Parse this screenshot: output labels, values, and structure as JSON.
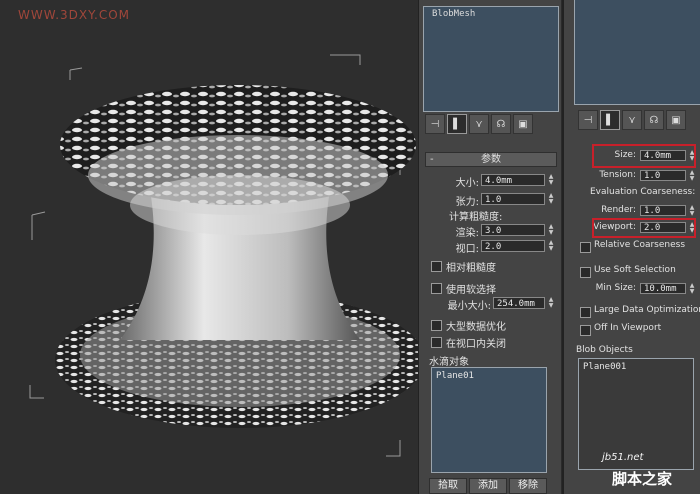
{
  "watermark": "WWW.3DXY.COM",
  "left_panel": {
    "mesh_list_title": "BlobMesh",
    "rollout": "参数",
    "size_label": "大小:",
    "size_value": "4.0mm",
    "tension_label": "张力:",
    "tension_value": "1.0",
    "coarseness_label": "计算粗糙度:",
    "render_label": "渲染:",
    "render_value": "3.0",
    "viewport_label": "视口:",
    "viewport_value": "2.0",
    "relative_label": "相对粗糙度",
    "soft_selection_label": "使用软选择",
    "min_size_label": "最小大小:",
    "min_size_value": "254.0mm",
    "large_data_label": "大型数据优化",
    "off_viewport_label": "在视口内关闭",
    "objects_label": "水滴对象",
    "objects_entry": "Plane01",
    "pick_label": "拾取",
    "add_label": "添加",
    "remove_label": "移除"
  },
  "right_panel": {
    "size_label": "Size:",
    "size_value": "4.0mm",
    "tension_label": "Tension:",
    "tension_value": "1.0",
    "coarseness_label": "Evaluation Coarseness:",
    "render_label": "Render:",
    "render_value": "1.0",
    "viewport_label": "Viewport:",
    "viewport_value": "2.0",
    "relative_label": "Relative Coarseness",
    "soft_selection_label": "Use Soft Selection",
    "min_size_label": "Min Size:",
    "min_size_value": "10.0mm",
    "large_data_label": "Large Data Optimization",
    "off_viewport_label": "Off In Viewport",
    "objects_label": "Blob Objects",
    "objects_entry": "Plane001"
  },
  "branding": {
    "site": "jb51.net",
    "name": "脚本之家"
  },
  "colors": {
    "highlight": "#c8202a",
    "listbox": "#3d4f60"
  }
}
